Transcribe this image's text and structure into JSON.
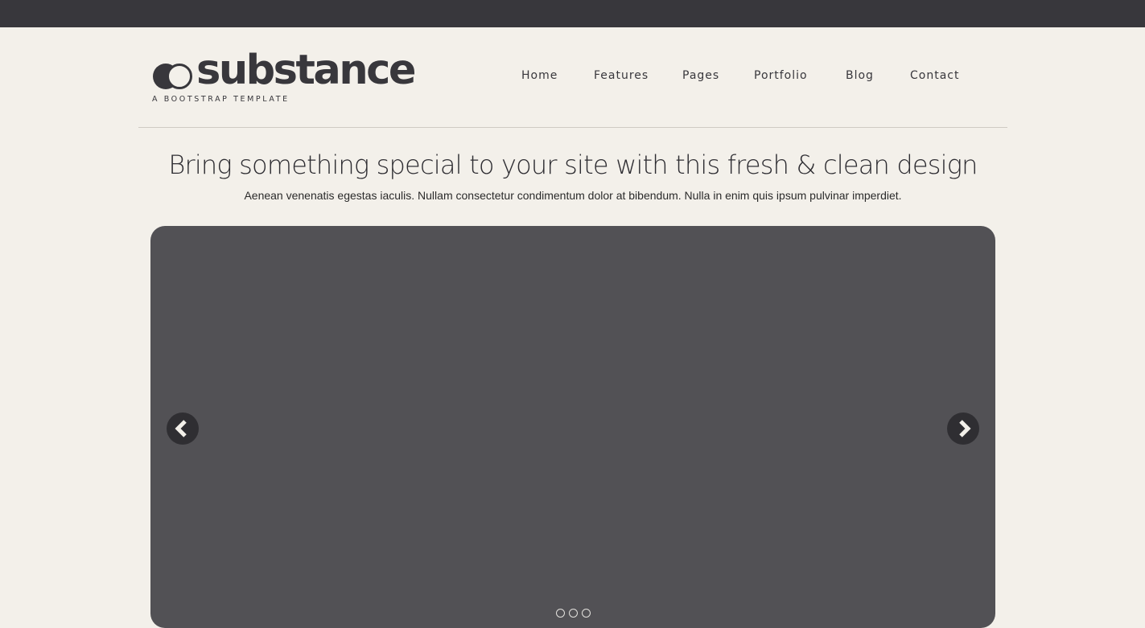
{
  "top_bar": {},
  "brand": {
    "name": "substance",
    "tagline": "A BOOTSTRAP TEMPLATE",
    "logo_icon": "double-circle-logo-icon"
  },
  "nav": {
    "items": [
      {
        "label": "Home"
      },
      {
        "label": "Features"
      },
      {
        "label": "Pages"
      },
      {
        "label": "Portfolio"
      },
      {
        "label": "Blog"
      },
      {
        "label": "Contact"
      }
    ]
  },
  "hero": {
    "headline": "Bring something special to your site with this fresh & clean design",
    "subheadline": "Aenean venenatis egestas iaculis. Nullam consectetur condimentum dolor at bibendum. Nulla in enim quis ipsum pulvinar imperdiet."
  },
  "slider": {
    "prev_icon": "chevron-left-icon",
    "next_icon": "chevron-right-icon",
    "slide_count": 3
  },
  "colors": {
    "page_background": "#f3f0ea",
    "top_bar": "#38373c",
    "text_dark": "#38373c",
    "slider_background": "#525155",
    "arrow_background": "#2f2e32"
  }
}
